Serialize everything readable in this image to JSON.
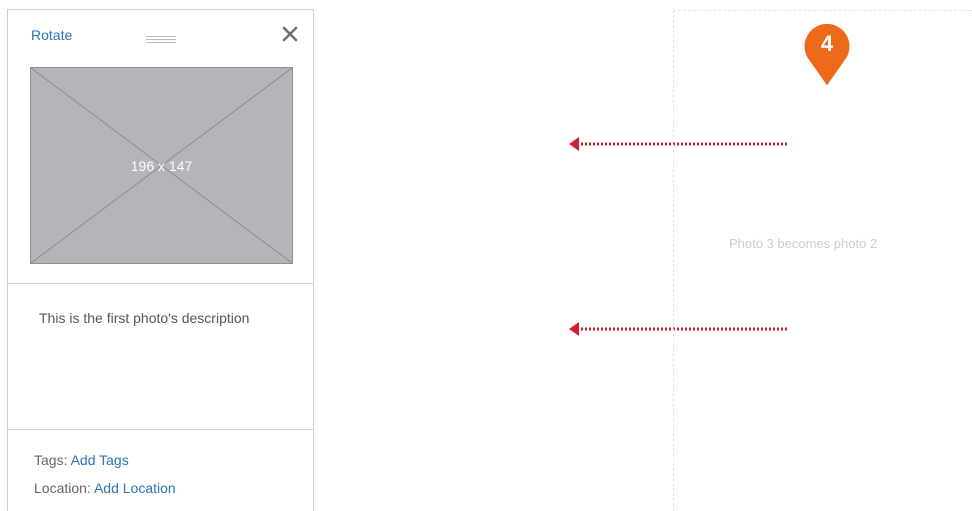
{
  "photo_card": {
    "rotate_label": "Rotate",
    "close_icon": "close-icon",
    "drag_icon": "drag-handle-icon",
    "thumbnail_size_label": "196 x 147",
    "description": "This is the first photo's description",
    "tags_label": "Tags:",
    "tags_link": "Add Tags",
    "location_label": "Location:",
    "location_link": "Add Location"
  },
  "drop_area": {
    "caption": "Photo 3 becomes photo 2"
  },
  "step_marker": {
    "number": "4",
    "color": "#ee6a1b"
  },
  "arrow_color": "#d4202e"
}
